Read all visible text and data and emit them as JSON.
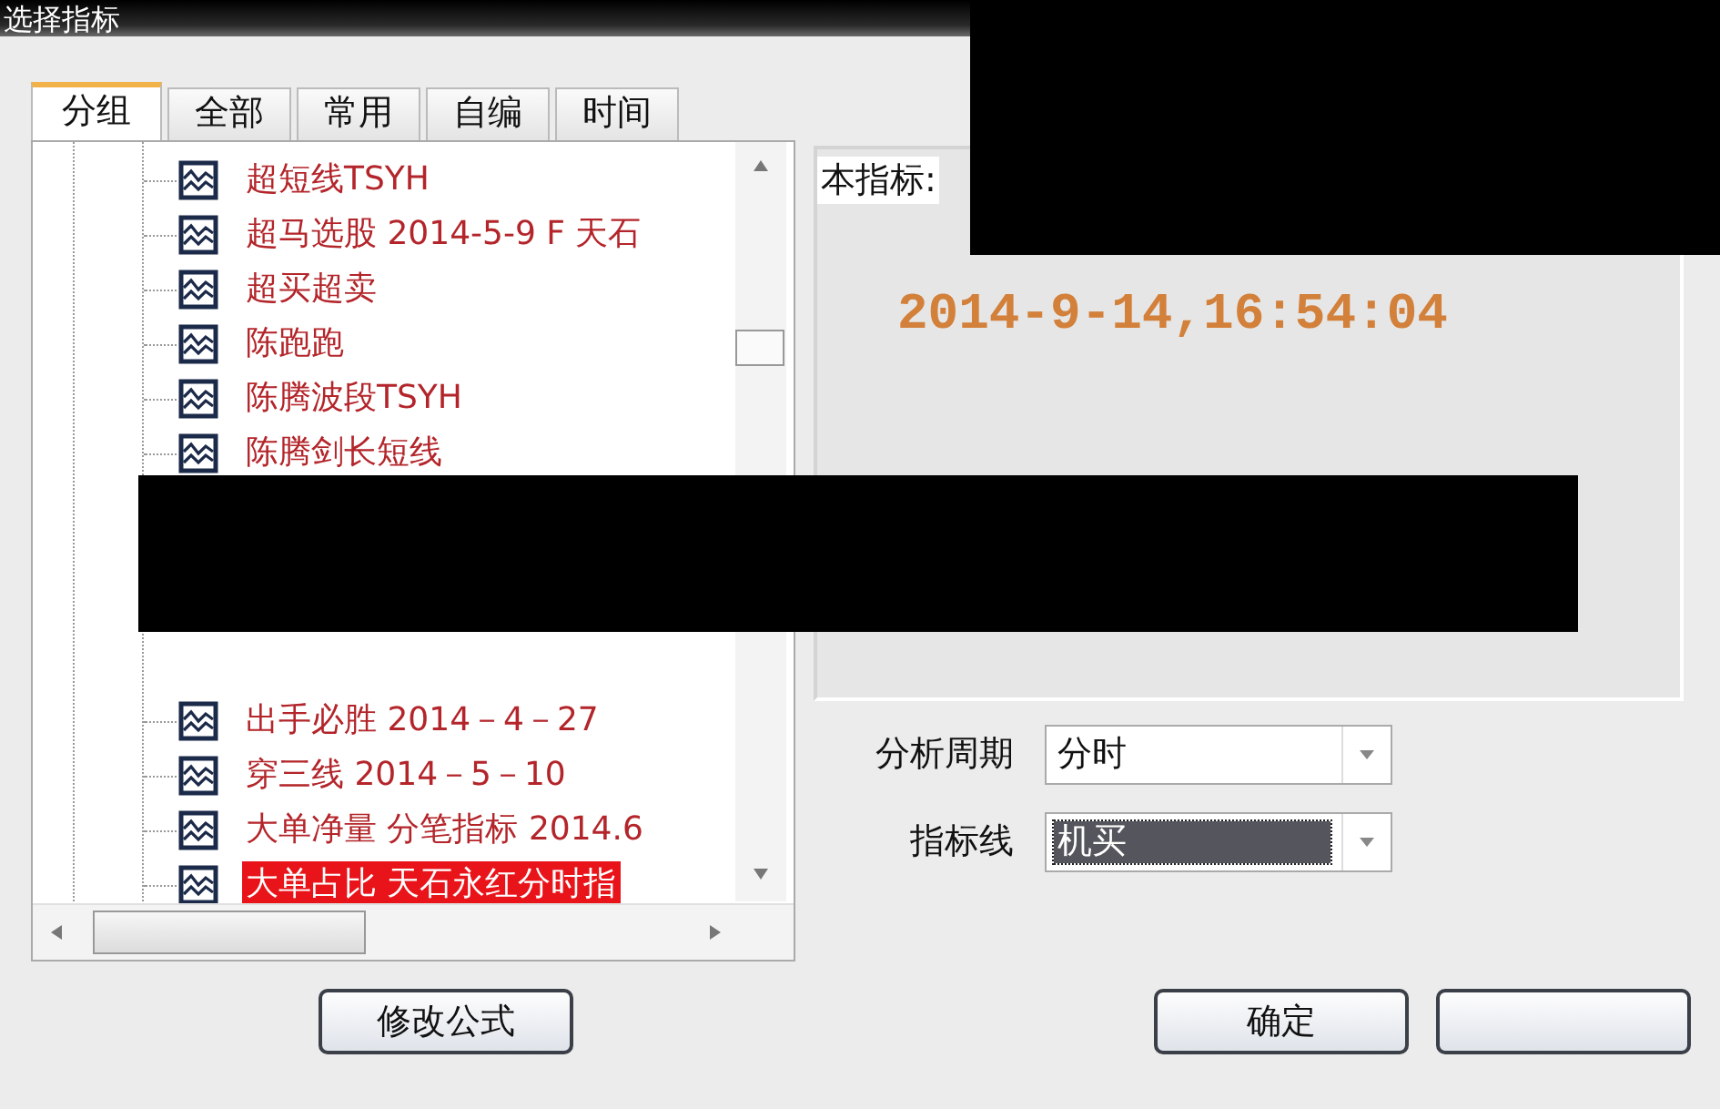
{
  "window": {
    "title": "选择指标"
  },
  "tabs": [
    {
      "label": "分组",
      "selected": true
    },
    {
      "label": "全部",
      "selected": false
    },
    {
      "label": "常用",
      "selected": false
    },
    {
      "label": "自编",
      "selected": false
    },
    {
      "label": "时间",
      "selected": false
    }
  ],
  "tree": {
    "top_items": [
      {
        "label": "超短线TSYH",
        "selected": false
      },
      {
        "label": "超马选股 2014-5-9 F 天石",
        "selected": false
      },
      {
        "label": "超买超卖",
        "selected": false
      },
      {
        "label": "陈跑跑",
        "selected": false
      },
      {
        "label": "陈腾波段TSYH",
        "selected": false
      },
      {
        "label": "陈腾剑长短线",
        "selected": false
      }
    ],
    "bottom_items": [
      {
        "label": "出手必胜 2014－4－27",
        "selected": false
      },
      {
        "label": "穿三线 2014－5－10",
        "selected": false
      },
      {
        "label": "大单净量 分笔指标 2014.6",
        "selected": false
      },
      {
        "label": "大单占比 天石永红分时指",
        "selected": true
      }
    ]
  },
  "info_panel": {
    "label": "本指标:",
    "timestamp": "2014-9-14,16:54:04"
  },
  "fields": [
    {
      "label": "分析周期",
      "value": "分时",
      "highlighted": false
    },
    {
      "label": "指标线",
      "value": "机买",
      "highlighted": true
    }
  ],
  "buttons": {
    "edit": "修改公式",
    "ok": "确定"
  }
}
